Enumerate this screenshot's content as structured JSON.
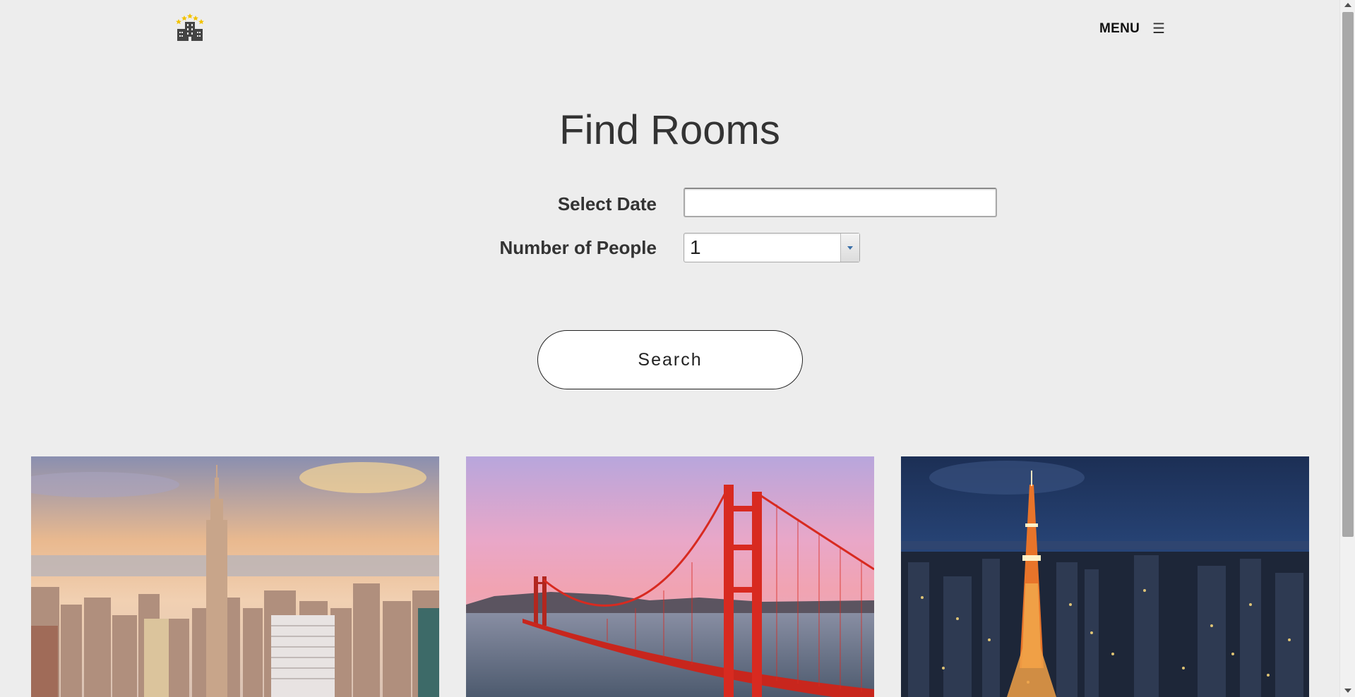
{
  "header": {
    "logo_icon": "hotel-building-stars-icon",
    "menu_label": "MENU",
    "menu_icon": "hamburger-icon",
    "menu_glyph": "☰"
  },
  "page_title": "Find Rooms",
  "form": {
    "date_label": "Select Date",
    "date_value": "",
    "people_label": "Number of People",
    "people_value": "1"
  },
  "search_button": "Search",
  "destinations": [
    {
      "image": "new-york-skyline-image"
    },
    {
      "image": "golden-gate-bridge-image"
    },
    {
      "image": "tokyo-tower-night-image"
    }
  ],
  "colors": {
    "background": "#ededed",
    "text": "#333333",
    "button_bg": "#ffffff",
    "star": "#f2c200"
  }
}
